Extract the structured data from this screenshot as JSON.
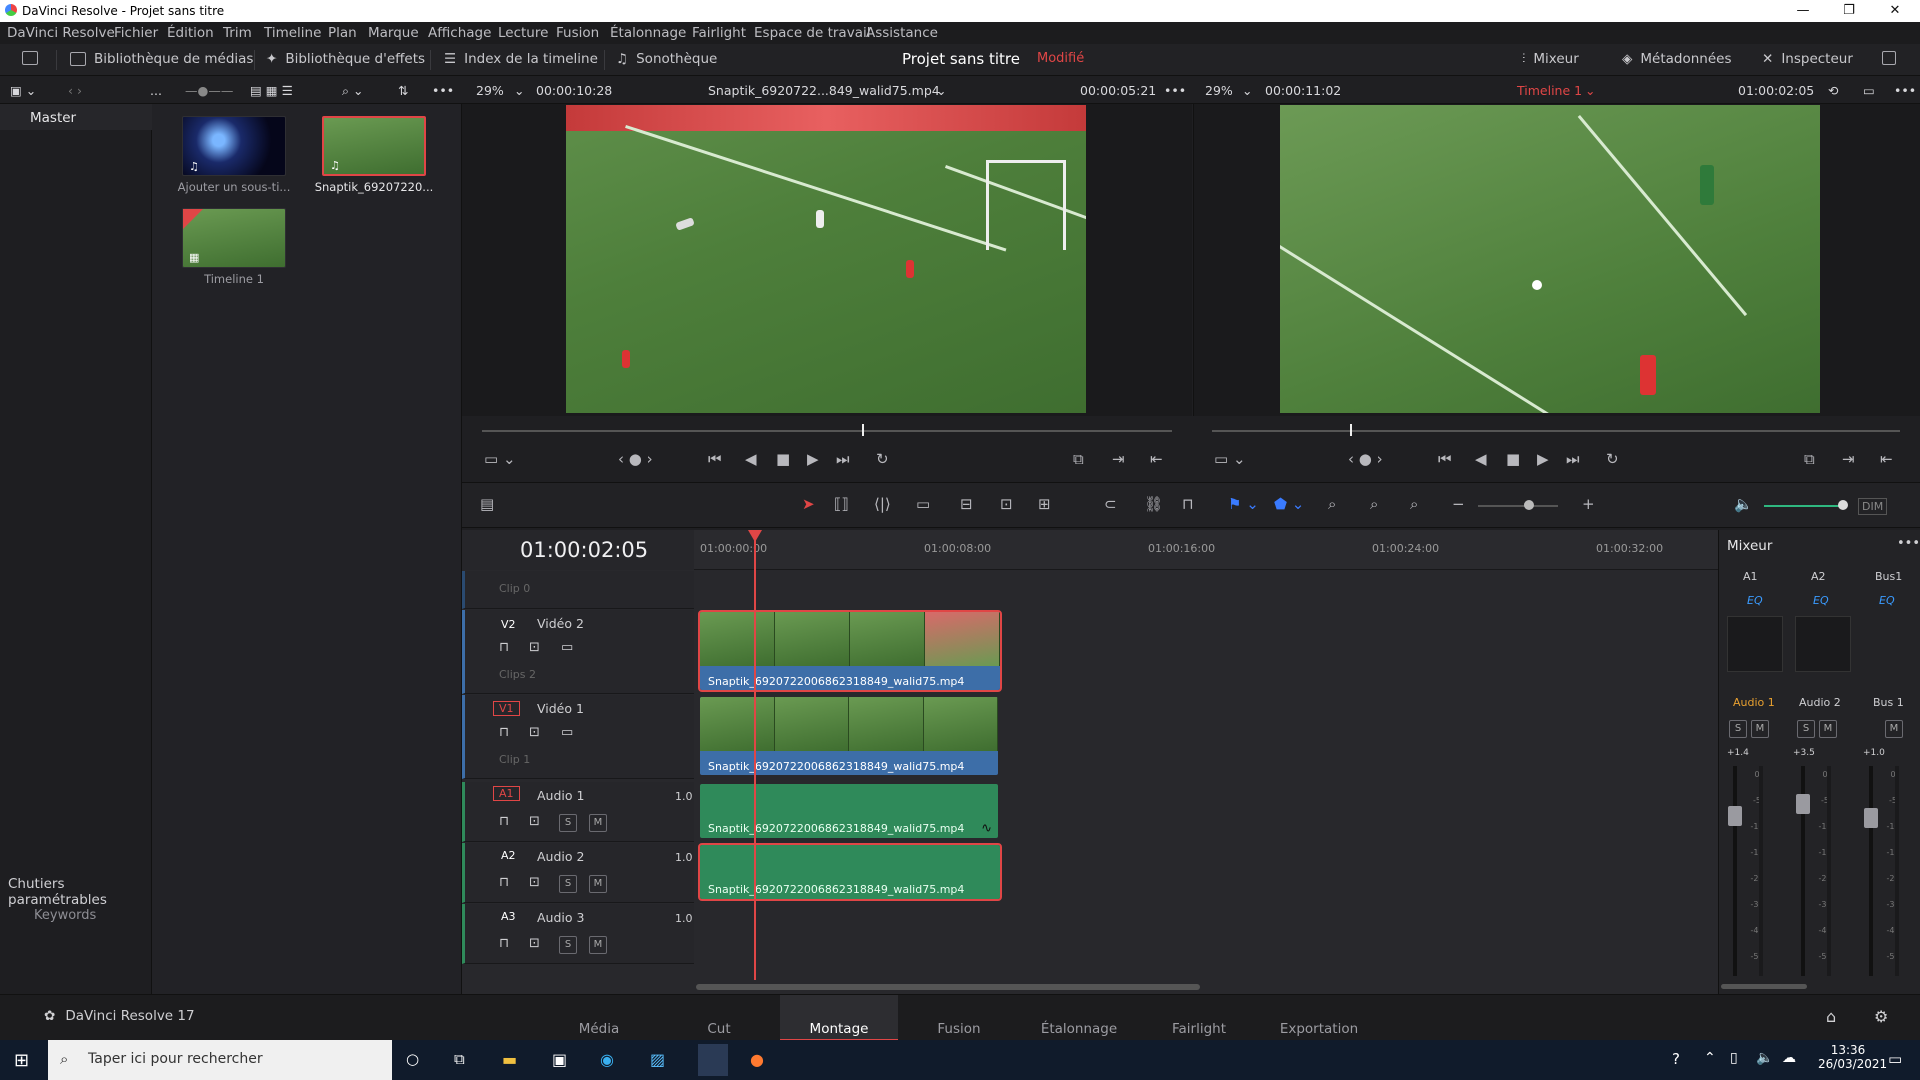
{
  "window": {
    "title": "DaVinci Resolve - Projet sans titre"
  },
  "menu": [
    "DaVinci Resolve",
    "Fichier",
    "Édition",
    "Trim",
    "Timeline",
    "Plan",
    "Marque",
    "Affichage",
    "Lecture",
    "Fusion",
    "Étalonnage",
    "Fairlight",
    "Espace de travail",
    "Assistance"
  ],
  "toolbar": {
    "media_pool": "Bibliothèque de médias",
    "effects": "Bibliothèque d'effets",
    "edit_index": "Index de la timeline",
    "sound_library": "Sonothèque",
    "project_title": "Projet sans titre",
    "modified": "Modifié",
    "mixer": "Mixeur",
    "metadata": "Métadonnées",
    "inspector": "Inspecteur"
  },
  "source": {
    "zoom": "29%",
    "timecode": "00:00:10:28",
    "clip_name": "Snaptik_6920722...849_walid75.mp4",
    "duration": "00:00:05:21",
    "playhead": 0.55
  },
  "program": {
    "zoom": "29%",
    "timecode": "00:00:11:02",
    "timeline_name": "Timeline 1",
    "current": "01:00:02:05",
    "playhead": 0.2
  },
  "bins": {
    "master": "Master",
    "smart_bins": "Chutiers paramétrables",
    "keywords": "Keywords"
  },
  "media_items": [
    {
      "label": "Ajouter un sous-ti..."
    },
    {
      "label": "Snaptik_69207220..."
    },
    {
      "label": "Timeline 1"
    }
  ],
  "timeline": {
    "current_tc": "01:00:02:05",
    "ruler": [
      "01:00:00:00",
      "01:00:08:00",
      "01:00:16:00",
      "01:00:24:00",
      "01:00:32:00"
    ]
  },
  "tracks": [
    {
      "id": "V2",
      "name": "Vidéo 2",
      "sub": "Clips 2",
      "clip": "Snaptik_6920722006862318849_walid75.mp4"
    },
    {
      "id": "V1",
      "name": "Vidéo 1",
      "sub": "Clip 1",
      "clip": "Snaptik_6920722006862318849_walid75.mp4"
    },
    {
      "id": "A1",
      "name": "Audio 1",
      "level": "1.0",
      "clip": "Snaptik_6920722006862318849_walid75.mp4"
    },
    {
      "id": "A2",
      "name": "Audio 2",
      "level": "1.0",
      "clip": "Snaptik_6920722006862318849_walid75.mp4"
    },
    {
      "id": "A3",
      "name": "Audio 3",
      "level": "1.0"
    }
  ],
  "clip0": "Clip 0",
  "mixer": {
    "title": "Mixeur",
    "channels": [
      "A1",
      "A2",
      "Bus1"
    ],
    "eq": "EQ",
    "names": [
      "Audio 1",
      "Audio 2",
      "Bus 1"
    ],
    "values": [
      "+1.4",
      "+3.5",
      "+1.0"
    ],
    "scale": [
      "0",
      "-5",
      "-10",
      "-15",
      "-20",
      "-30",
      "-40",
      "-50"
    ]
  },
  "pages": [
    "Média",
    "Cut",
    "Montage",
    "Fusion",
    "Étalonnage",
    "Fairlight",
    "Exportation"
  ],
  "active_page": "Montage",
  "app_version": "DaVinci Resolve 17",
  "taskbar": {
    "search_placeholder": "Taper ici pour rechercher",
    "time": "13:36",
    "date": "26/03/2021"
  },
  "labels": {
    "s": "S",
    "m": "M",
    "dim": "DIM"
  }
}
